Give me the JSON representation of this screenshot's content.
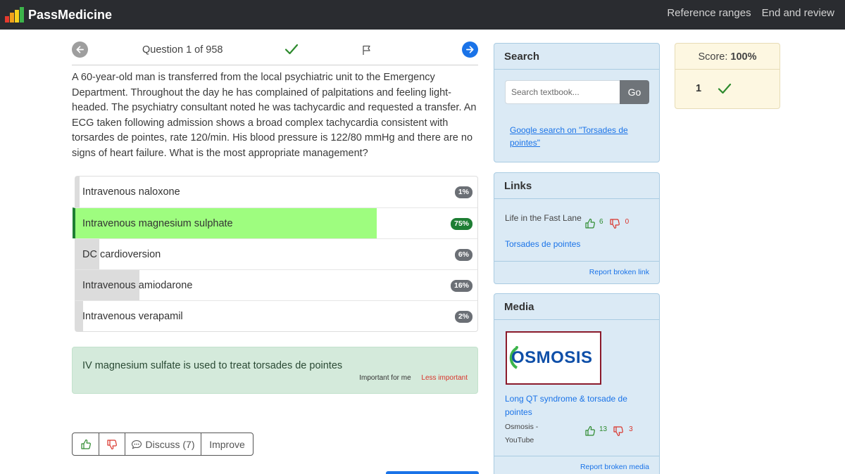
{
  "navbar": {
    "brand": "PassMedicine",
    "links": [
      "Reference ranges",
      "End and review"
    ],
    "logo_colors": [
      "#e63a2e",
      "#f2a21b",
      "#f7d21e",
      "#3cb44b"
    ]
  },
  "question_header": {
    "counter": "Question 1 of 958",
    "prev_icon": "arrow-left-icon",
    "next_icon": "arrow-right-icon"
  },
  "question": {
    "text": "A 60-year-old man is transferred from the local psychiatric unit to the Emergency Department. Throughout the day he has complained of palpitations and feeling light-headed. The psychiatry consultant noted he was tachycardic and requested a transfer. An ECG taken following admission shows a broad complex tachycardia consistent with torsardes de pointes, rate 120/min. His blood pressure is 122/80 mmHg and there are no signs of heart failure. What is the most appropriate management?"
  },
  "answers": [
    {
      "text": "Intravenous naloxone",
      "percent_label": "1%",
      "percent": 1,
      "correct": false
    },
    {
      "text": "Intravenous magnesium sulphate",
      "percent_label": "75%",
      "percent": 75,
      "correct": true
    },
    {
      "text": "DC cardioversion",
      "percent_label": "6%",
      "percent": 6,
      "correct": false
    },
    {
      "text": "Intravenous amiodarone",
      "percent_label": "16%",
      "percent": 16,
      "correct": false
    },
    {
      "text": "Intravenous verapamil",
      "percent_label": "2%",
      "percent": 2,
      "correct": false
    }
  ],
  "explanation": {
    "text": "IV magnesium sulfate is used to treat torsades de pointes",
    "important_label": "Important for me",
    "less_important_label": "Less important"
  },
  "actions": {
    "discuss_label": "Discuss (7)",
    "improve_label": "Improve"
  },
  "search": {
    "title": "Search",
    "placeholder": "Search textbook...",
    "go_label": "Go",
    "google_link": "Google search on \"Torsades de pointes\""
  },
  "links": {
    "title": "Links",
    "item_title": "Life in the Fast Lane",
    "item_link": "Torsades de pointes",
    "upvotes": "6",
    "downvotes": "0",
    "report_label": "Report broken link"
  },
  "media": {
    "title": "Media",
    "thumbnail_text": "OSMOSIS",
    "item_title": "Long QT syndrome & torsade de pointes",
    "item_source": "Osmosis - YouTube",
    "upvotes": "13",
    "downvotes": "3",
    "report_label": "Report broken media"
  },
  "score": {
    "label": "Score:",
    "value": "100%",
    "question_number": "1"
  },
  "colors": {
    "correct_fill": "#9efd7f",
    "correct_border": "#1e7e34",
    "link_blue": "#1a73e8"
  }
}
